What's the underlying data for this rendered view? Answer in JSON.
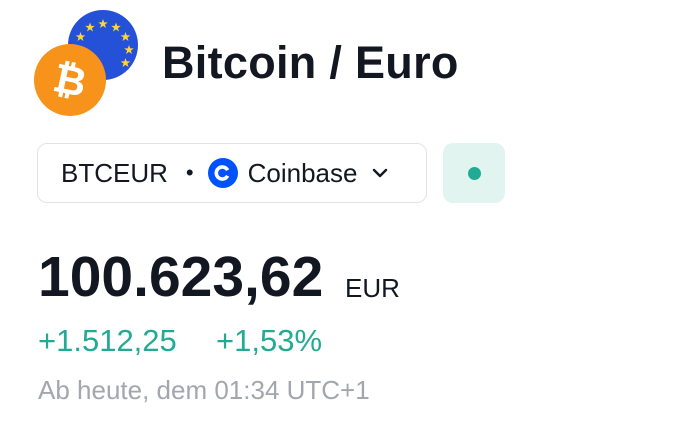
{
  "header": {
    "title": "Bitcoin / Euro",
    "icons": {
      "base": "bitcoin-icon",
      "quote": "euro-flag-icon"
    }
  },
  "symbol": {
    "ticker": "BTCEUR",
    "separator": "•",
    "exchange": "Coinbase",
    "exchange_icon": "coinbase-icon",
    "dropdown_icon": "chevron-down-icon"
  },
  "market_status": {
    "icon": "market-open-dot-icon",
    "color": "#22ab94"
  },
  "quote": {
    "price": "100.623,62",
    "currency": "EUR",
    "change": "+1.512,25",
    "change_percent": "+1,53%",
    "timestamp": "Ab heute, dem 01:34 UTC+1"
  },
  "colors": {
    "positive": "#22ab94",
    "bitcoin": "#f7931a",
    "euro_blue": "#2962ff",
    "coinbase": "#0052ff"
  }
}
